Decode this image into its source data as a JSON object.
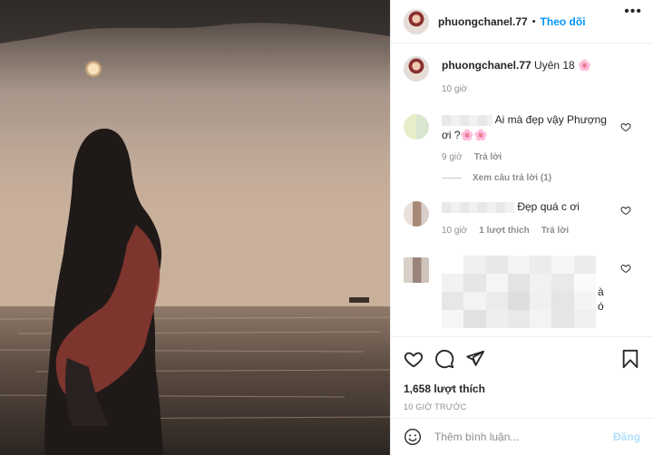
{
  "header": {
    "username": "phuongchanel.77",
    "separator": "•",
    "follow_label": "Theo dõi",
    "more_label": "•••"
  },
  "caption": {
    "username": "phuongchanel.77",
    "text": "Uyên 18 🌸",
    "time": "10 giờ"
  },
  "comments": [
    {
      "text_line1": "Ai mà đẹp vậy Phượng",
      "text_line2": "ơi ?🌸🌸",
      "time": "9 giờ",
      "reply_label": "Trả lời",
      "view_replies": "Xem câu trả lời (1)"
    },
    {
      "text": "Đẹp quá c ơi",
      "time": "10 giờ",
      "likes": "1 lượt thích",
      "reply_label": "Trả lời"
    },
    {
      "fragment_line1": "à",
      "fragment_line2": "ó"
    }
  ],
  "post": {
    "likes": "1,658 lượt thích",
    "time": "10 GIỜ TRƯỚC"
  },
  "composer": {
    "placeholder": "Thêm bình luận...",
    "post_label": "Đăng"
  },
  "colors": {
    "link_blue": "#0095f6",
    "post_disabled": "#b2dffc",
    "muted": "#8e8e8e"
  }
}
